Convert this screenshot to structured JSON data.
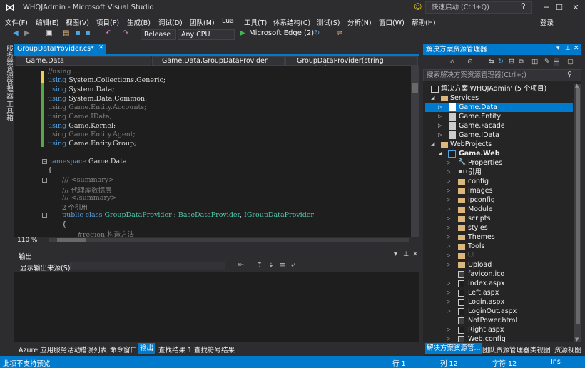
{
  "window": {
    "title": "WHQJAdmin - Microsoft Visual Studio",
    "quick_launch": "快速启动 (Ctrl+Q)",
    "login": "登录"
  },
  "menu": [
    "文件(F)",
    "编辑(E)",
    "视图(V)",
    "项目(P)",
    "生成(B)",
    "调试(D)",
    "团队(M)",
    "Lua",
    "工具(T)",
    "体系结构(C)",
    "测试(S)",
    "分析(N)",
    "窗口(W)",
    "帮助(H)"
  ],
  "toolbar": {
    "config": "Release",
    "platform": "Any CPU",
    "run_target": "Microsoft Edge (2)"
  },
  "left_strip": {
    "server_explorer": "服务器资源管理器",
    "toolbox": "工具箱"
  },
  "editor": {
    "tab": "GroupDataProvider.cs*",
    "nav_project": "Game.Data",
    "nav_class": "Game.Data.GroupDataProvider",
    "nav_member": "GroupDataProvider(string connString)",
    "zoom": "110 %",
    "lines": {
      "l0": "//using ...",
      "l1k": "using",
      "l1": " System.Collections.Generic;",
      "l2k": "using",
      "l2": " System.Data;",
      "l3k": "using",
      "l3": " System.Data.Common;",
      "l4k": "using",
      "l4": " Game.Entity.Accounts;",
      "l5k": "using",
      "l5": " Game.IData;",
      "l6k": "using",
      "l6": " Game.Kernel;",
      "l7k": "using",
      "l7": " Game.Entity.Agent;",
      "l8k": "using",
      "l8": " Game.Entity.Group;",
      "ns_k": "namespace",
      "ns": " Game.Data",
      "brace1": "{",
      "s1": "/// <summary>",
      "s2": "/// 代理库数据层",
      "s3": "/// </summary>",
      "refs": "2 个引用",
      "cls_k": "public class ",
      "cls_t": "GroupDataProvider",
      "cls_r": " : ",
      "cls_b": "BaseDataProvider",
      "cls_c": ", ",
      "cls_i": "IGroupDataProvider",
      "brace2": "{",
      "region": "#region 构造方法"
    }
  },
  "output": {
    "title": "输出",
    "source_label": "显示输出来源(S):"
  },
  "bottom_tabs": [
    "Azure 应用服务活动",
    "错误列表",
    "命令窗口",
    "输出",
    "查找结果 1",
    "查找符号结果"
  ],
  "solution": {
    "title": "解决方案资源管理器",
    "search": "搜索解决方案资源管理器(Ctrl+;)",
    "root": "解决方案'WHQJAdmin' (5 个项目)",
    "services": "Services",
    "projects": [
      "Game.Data",
      "Game.Entity",
      "Game.Facade",
      "Game.IData"
    ],
    "webprojects": "WebProjects",
    "gameweb": "Game.Web",
    "items": [
      "Properties",
      "引用",
      "config",
      "images",
      "ipconfig",
      "Module",
      "scripts",
      "styles",
      "Themes",
      "Tools",
      "UI",
      "Upload",
      "favicon.ico",
      "Index.aspx",
      "Left.aspx",
      "Login.aspx",
      "LoginOut.aspx",
      "NotPower.html",
      "Right.aspx",
      "Web.config"
    ],
    "tabs": [
      "解决方案资源管...",
      "团队资源管理器",
      "类视图",
      "资源视图"
    ]
  },
  "status": {
    "left": "此项不支持预览",
    "line": "行 1",
    "col": "列 12",
    "ch": "字符 12",
    "mode": "Ins"
  },
  "colors": {
    "accent": "#007acc",
    "keyword": "#569cd6",
    "type": "#4ec9b0",
    "comment": "#57a64a"
  }
}
